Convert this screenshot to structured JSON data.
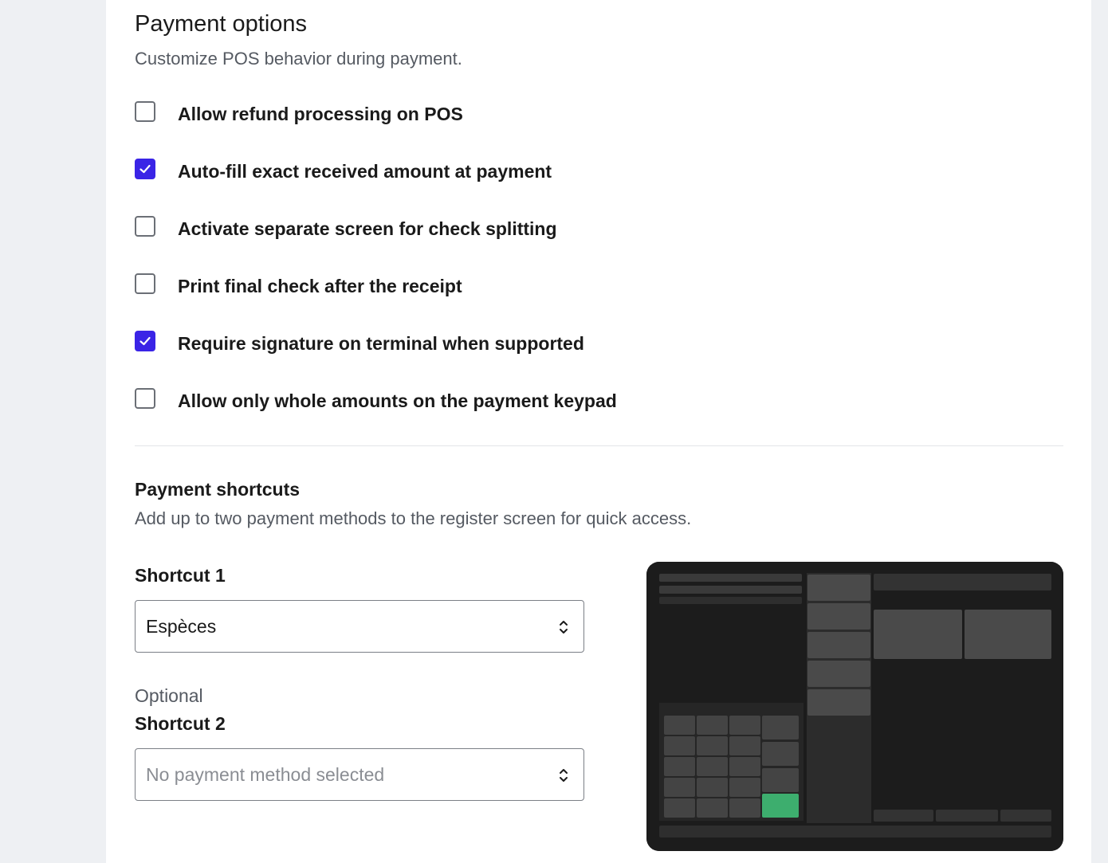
{
  "payment_options": {
    "title": "Payment options",
    "subtitle": "Customize POS behavior during payment.",
    "options": [
      {
        "label": "Allow refund processing on POS",
        "checked": false
      },
      {
        "label": "Auto-fill exact received amount at payment",
        "checked": true
      },
      {
        "label": "Activate separate screen for check splitting",
        "checked": false
      },
      {
        "label": "Print final check after the receipt",
        "checked": false
      },
      {
        "label": "Require signature on terminal when supported",
        "checked": true
      },
      {
        "label": "Allow only whole amounts on the payment keypad",
        "checked": false
      }
    ]
  },
  "payment_shortcuts": {
    "title": "Payment shortcuts",
    "subtitle": "Add up to two payment methods to the register screen for quick access.",
    "shortcut1": {
      "label": "Shortcut 1",
      "value": "Espèces"
    },
    "shortcut2": {
      "optional_note": "Optional",
      "label": "Shortcut 2",
      "placeholder": "No payment method selected"
    }
  },
  "colors": {
    "accent": "#3a24e6",
    "preview_highlight": "#3dae6e"
  },
  "icons": {
    "check": "check-icon",
    "select_chevron": "chevron-up-down-icon"
  }
}
